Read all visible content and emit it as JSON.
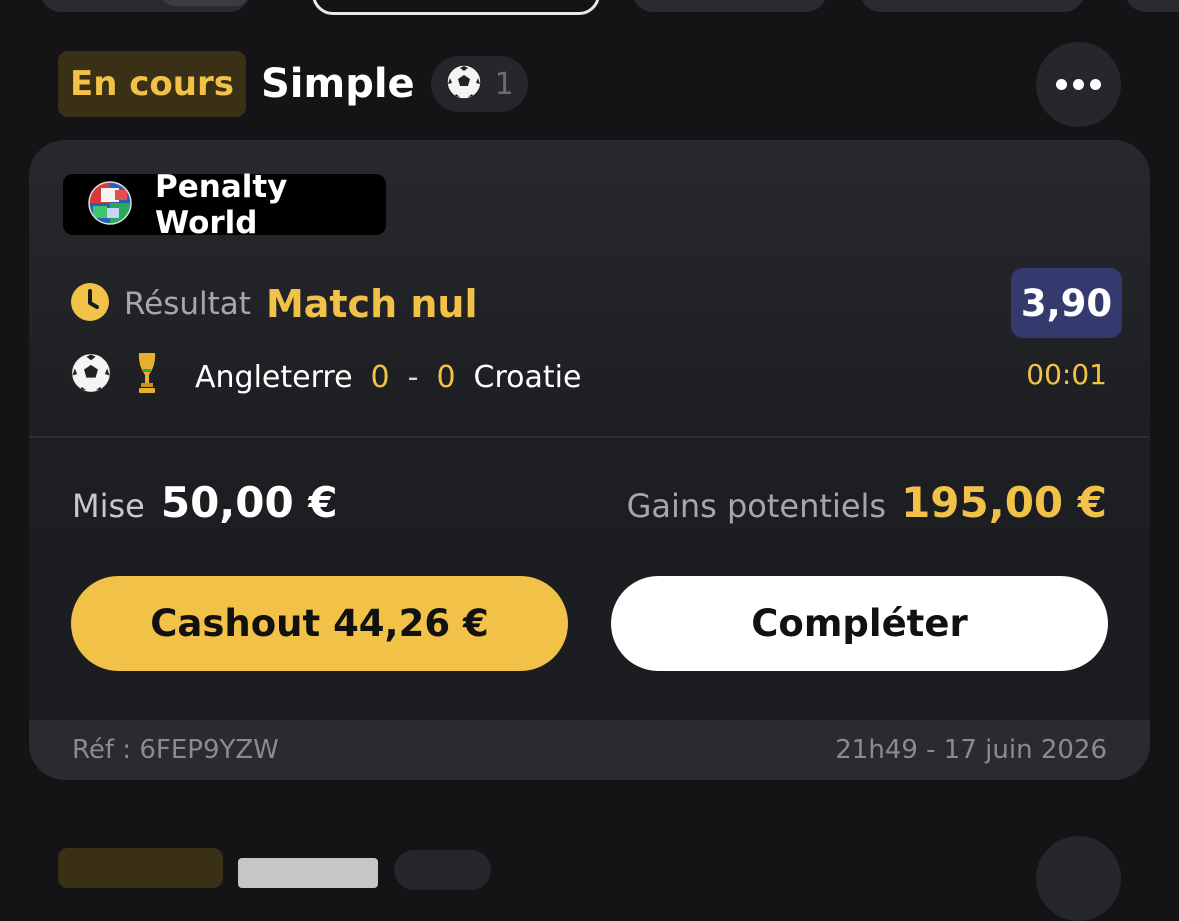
{
  "bet": {
    "status": "En cours",
    "type": "Simple",
    "selection_count": "1",
    "sport_icon": "soccer-ball-icon",
    "more_icon": "more-horizontal-icon"
  },
  "game": {
    "name": "Penalty World",
    "logo_icon": "penalty-world-globe-icon"
  },
  "selection": {
    "market_label": "Résultat",
    "pick": "Match nul",
    "odds": "3,90",
    "status_icon": "clock-icon",
    "home_team": "Angleterre",
    "home_score": "0",
    "separator": "-",
    "away_score": "0",
    "away_team": "Croatie",
    "time": "00:01"
  },
  "summary": {
    "stake_label": "Mise",
    "stake_value": "50,00 €",
    "gains_label": "Gains potentiels",
    "gains_value": "195,00 €"
  },
  "actions": {
    "cashout_label": "Cashout 44,26 €",
    "complete_label": "Compléter"
  },
  "footer": {
    "reference": "Réf : 6FEP9YZW",
    "datetime": "21h49 - 17 juin 2026"
  },
  "colors": {
    "accent": "#f2c248",
    "odds_bg": "#343a6e",
    "card_bg": "#1d1e22",
    "page_bg": "#141416"
  }
}
